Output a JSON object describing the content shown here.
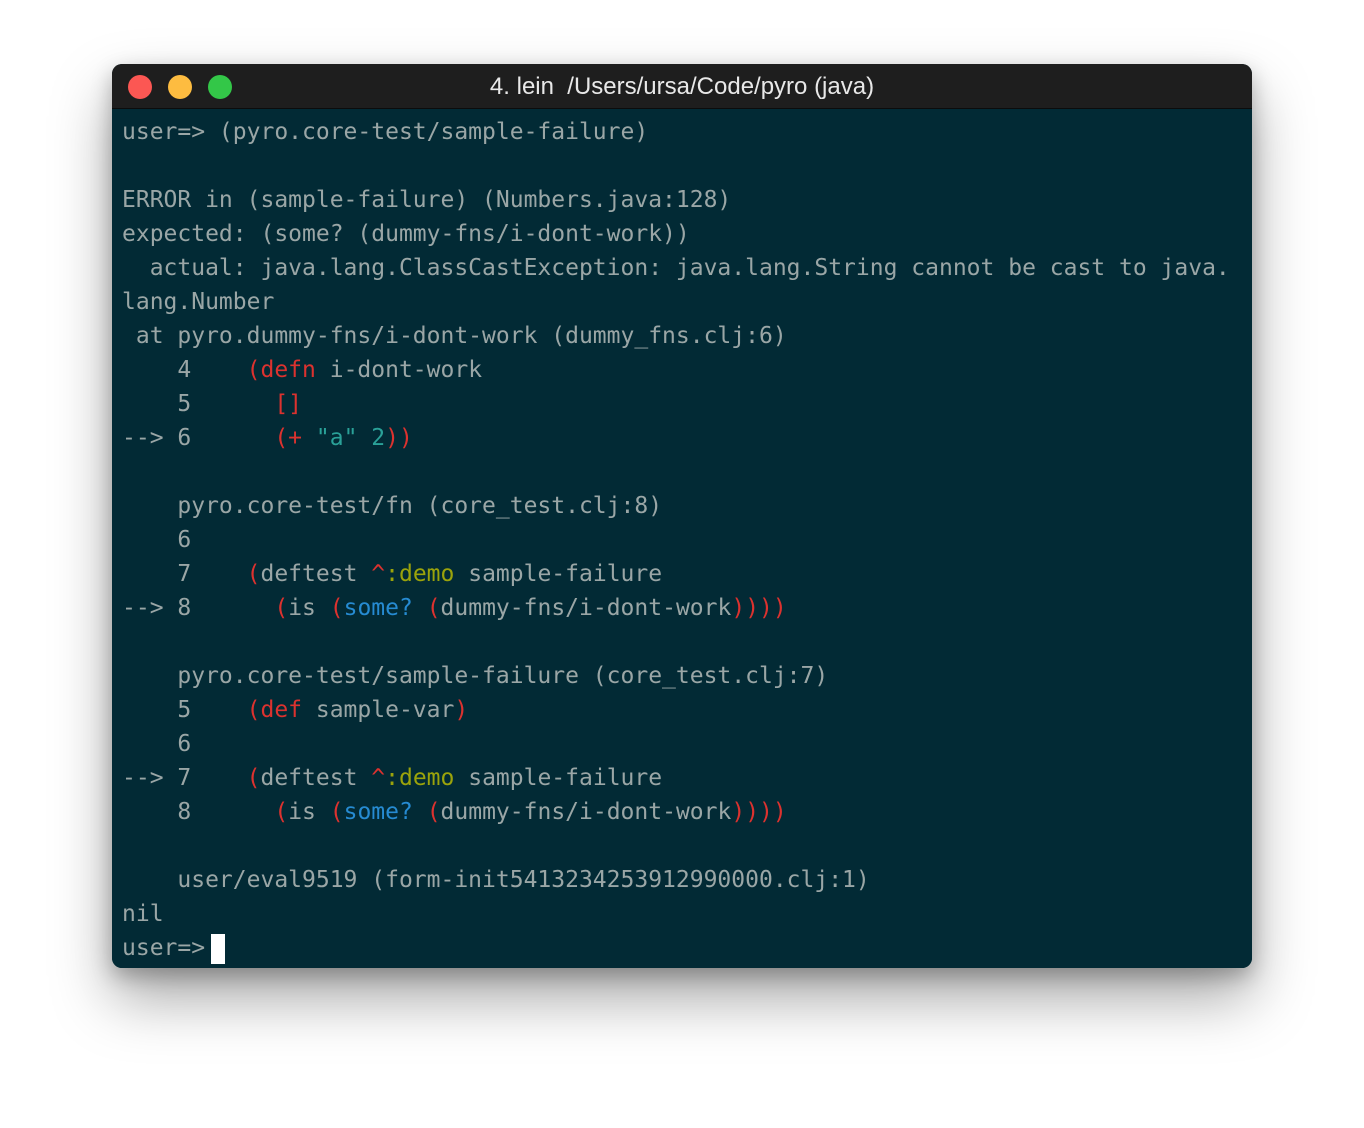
{
  "window": {
    "title": "4. lein  /Users/ursa/Code/pyro (java)"
  },
  "terminal": {
    "line_00": "user=> (pyro.core-test/sample-failure)",
    "line_02": "ERROR in (sample-failure) (Numbers.java:128)",
    "line_03": "expected: (some? (dummy-fns/i-dont-work))",
    "line_04": "  actual: java.lang.ClassCastException: java.lang.String cannot be cast to java.",
    "line_05": "lang.Number",
    "line_06": " at pyro.dummy-fns/i-dont-work (dummy_fns.clj:6)",
    "f1": {
      "l1_prefix": "    4    ",
      "l1_op": "(defn",
      "l1_rest": " i-dont-work",
      "l2_prefix": "    5      ",
      "l2_vec": "[]",
      "l3_prefix": "--> 6      ",
      "l3_open": "(+",
      "l3_str": " \"a\"",
      "l3_num": " 2",
      "l3_close": "))"
    },
    "f2": {
      "header": "    pyro.core-test/fn (core_test.clj:8)",
      "l1": "    6",
      "l2_prefix": "    7    ",
      "l2_open": "(",
      "l2_kw": "deftest",
      "l2_caret": " ^",
      "l2_meta": ":demo",
      "l2_rest": " sample-failure",
      "l3_prefix": "--> 8      ",
      "l3_open1": "(",
      "l3_is": "is ",
      "l3_open2": "(",
      "l3_some": "some? ",
      "l3_open3": "(",
      "l3_call": "dummy-fns/i-dont-work",
      "l3_close": "))))"
    },
    "f3": {
      "header": "    pyro.core-test/sample-failure (core_test.clj:7)",
      "l1_prefix": "    5    ",
      "l1_open": "(def",
      "l1_rest": " sample-var",
      "l1_close": ")",
      "l2": "    6",
      "l3_prefix": "--> 7    ",
      "l3_open": "(",
      "l3_kw": "deftest",
      "l3_caret": " ^",
      "l3_meta": ":demo",
      "l3_rest": " sample-failure",
      "l4_prefix": "    8      ",
      "l4_open1": "(",
      "l4_is": "is ",
      "l4_open2": "(",
      "l4_some": "some? ",
      "l4_open3": "(",
      "l4_call": "dummy-fns/i-dont-work",
      "l4_close": "))))"
    },
    "f4_header": "    user/eval9519 (form-init5413234253912990000.clj:1)",
    "result": "nil",
    "prompt": "user=>"
  },
  "colors": {
    "background": "#002b36",
    "text": "#9aa6a6",
    "red": "#dc322f",
    "cyan": "#2aa198",
    "blue": "#268bd2",
    "olive": "#9ba30b"
  }
}
